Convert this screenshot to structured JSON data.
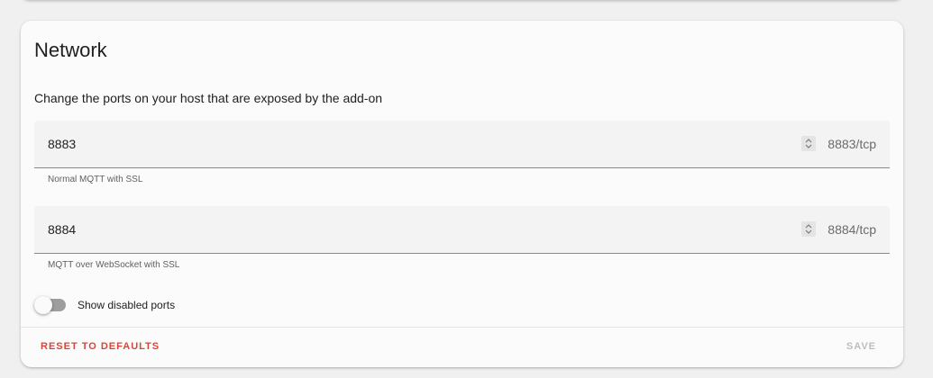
{
  "card": {
    "title": "Network",
    "description": "Change the ports on your host that are exposed by the add-on"
  },
  "ports": [
    {
      "value": "8883",
      "suffix": "8883/tcp",
      "helper": "Normal MQTT with SSL",
      "stepper_icon": "unfold-icon"
    },
    {
      "value": "8884",
      "suffix": "8884/tcp",
      "helper": "MQTT over WebSocket with SSL",
      "stepper_icon": "unfold-icon"
    }
  ],
  "toggle": {
    "label": "Show disabled ports",
    "checked": false
  },
  "actions": {
    "reset_label": "RESET TO DEFAULTS",
    "save_label": "SAVE",
    "save_enabled": false
  },
  "colors": {
    "reset": "#db4437",
    "save_disabled": "#bdbdbd",
    "toggle_off_track": "#9e9e9e"
  }
}
